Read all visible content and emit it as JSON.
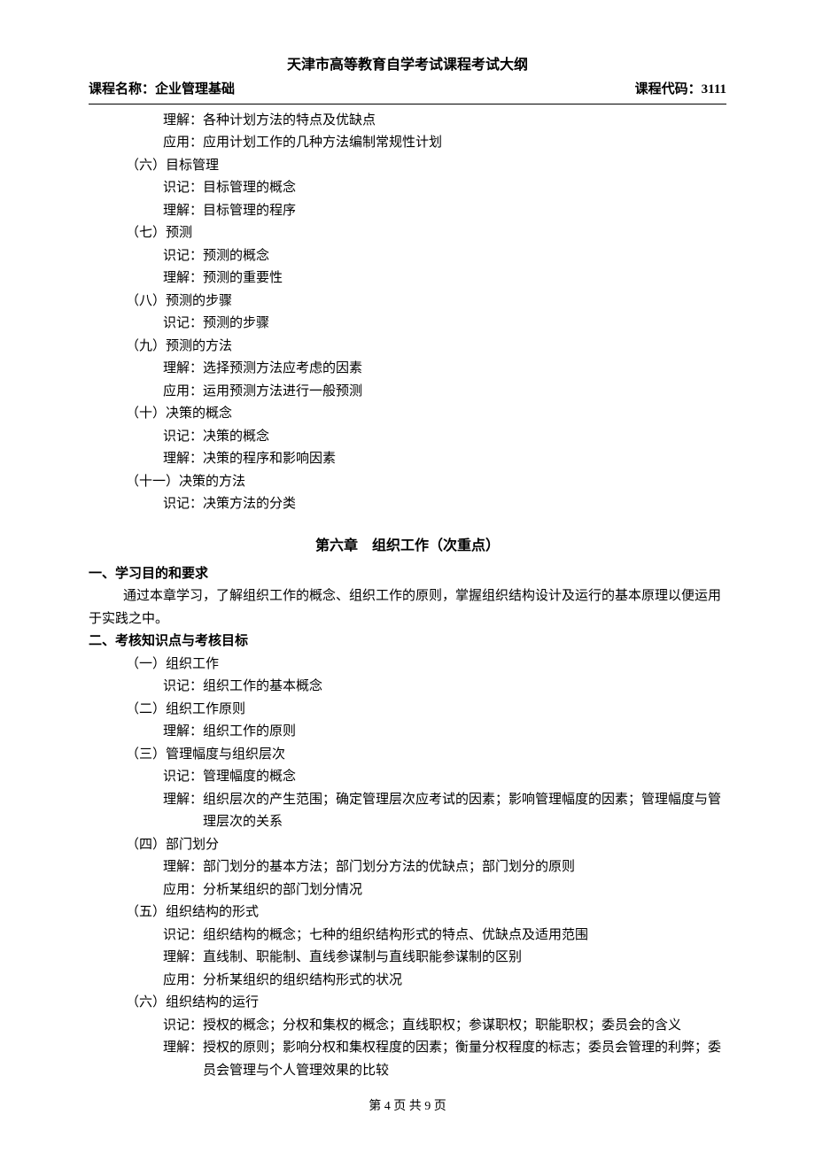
{
  "title": "天津市高等教育自学考试课程考试大纲",
  "header": {
    "course_name_label": "课程名称：企业管理基础",
    "course_code_label": "课程代码：3111"
  },
  "top_section": {
    "lines_indent2": [
      "理解：各种计划方法的特点及优缺点",
      "应用：应用计划工作的几种方法编制常规性计划"
    ],
    "items": [
      {
        "num": "（六）目标管理",
        "subs": [
          "识记：目标管理的概念",
          "理解：目标管理的程序"
        ]
      },
      {
        "num": "（七）预测",
        "subs": [
          "识记：预测的概念",
          "理解：预测的重要性"
        ]
      },
      {
        "num": "（八）预测的步骤",
        "subs": [
          "识记：预测的步骤"
        ]
      },
      {
        "num": "（九）预测的方法",
        "subs": [
          "理解：选择预测方法应考虑的因素",
          "应用：运用预测方法进行一般预测"
        ]
      },
      {
        "num": "（十）决策的概念",
        "subs": [
          "识记：决策的概念",
          "理解：决策的程序和影响因素"
        ]
      },
      {
        "num": "（十一）决策的方法",
        "subs": [
          "识记：决策方法的分类"
        ]
      }
    ]
  },
  "chapter6": {
    "title": "第六章　组织工作（次重点）",
    "sec1_heading": "一、学习目的和要求",
    "sec1_para": "通过本章学习，了解组织工作的概念、组织工作的原则，掌握组织结构设计及运行的基本原理以便运用于实践之中。",
    "sec2_heading": "二、考核知识点与考核目标",
    "items": [
      {
        "num": "（一）组织工作",
        "subs": [
          "识记：组织工作的基本概念"
        ]
      },
      {
        "num": "（二）组织工作原则",
        "subs": [
          "理解：组织工作的原则"
        ]
      },
      {
        "num": "（三）管理幅度与组织层次",
        "subs": [
          "识记：管理幅度的概念",
          "理解：组织层次的产生范围；确定管理层次应考试的因素；影响管理幅度的因素；管理幅度与管理层次的关系"
        ]
      },
      {
        "num": "（四）部门划分",
        "subs": [
          "理解：部门划分的基本方法；部门划分方法的优缺点；部门划分的原则",
          "应用：分析某组织的部门划分情况"
        ]
      },
      {
        "num": "（五）组织结构的形式",
        "subs": [
          "识记：组织结构的概念；七种的组织结构形式的特点、优缺点及适用范围",
          "理解：直线制、职能制、直线参谋制与直线职能参谋制的区别",
          "应用：分析某组织的组织结构形式的状况"
        ]
      },
      {
        "num": "（六）组织结构的运行",
        "subs": [
          "识记：授权的概念；分权和集权的概念；直线职权；参谋职权；职能职权；委员会的含义",
          "理解：授权的原则；影响分权和集权程度的因素；衡量分权程度的标志；委员会管理的利弊；委员会管理与个人管理效果的比较"
        ]
      }
    ]
  },
  "footer": "第 4 页 共 9 页"
}
